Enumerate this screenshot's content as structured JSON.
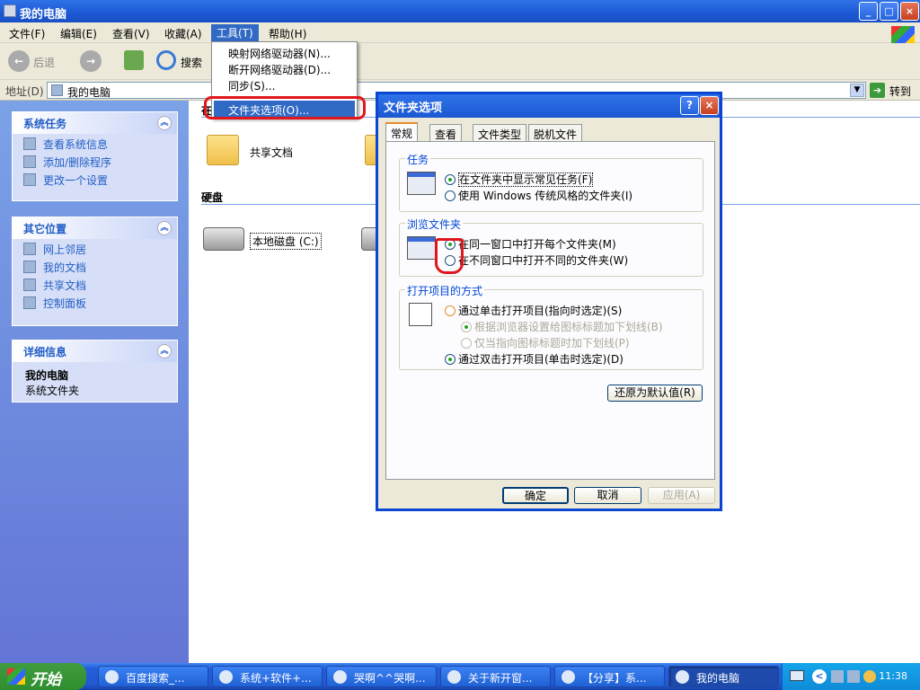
{
  "window": {
    "title": "我的电脑",
    "btn_min": "_",
    "btn_max": "□",
    "btn_close": "×"
  },
  "menubar": [
    "文件(F)",
    "编辑(E)",
    "查看(V)",
    "收藏(A)",
    "工具(T)",
    "帮助(H)"
  ],
  "toolbar": {
    "back": "后退",
    "search": "搜索"
  },
  "address": {
    "label": "地址(D)",
    "value": "我的电脑",
    "go": "转到"
  },
  "tools_menu": [
    "映射网络驱动器(N)...",
    "断开网络驱动器(D)...",
    "同步(S)...",
    "文件夹选项(O)..."
  ],
  "sidebar": {
    "system_tasks": {
      "title": "系统任务",
      "items": [
        "查看系统信息",
        "添加/删除程序",
        "更改一个设置"
      ]
    },
    "other_places": {
      "title": "其它位置",
      "items": [
        "网上邻居",
        "我的文档",
        "共享文档",
        "控制面板"
      ]
    },
    "details": {
      "title": "详细信息",
      "name": "我的电脑",
      "desc": "系统文件夹"
    }
  },
  "content": {
    "section1_prefix": "在",
    "shared_docs": "共享文档",
    "hdd_header": "硬盘",
    "local_disk": "本地磁盘 (C:)"
  },
  "dialog": {
    "title": "文件夹选项",
    "help": "?",
    "close": "×",
    "tabs": [
      "常规",
      "查看",
      "文件类型",
      "脱机文件"
    ],
    "tasks": {
      "legend": "任务",
      "opt1": "在文件夹中显示常见任务(F)",
      "opt2": "使用 Windows 传统风格的文件夹(I)"
    },
    "browse": {
      "legend": "浏览文件夹",
      "opt1": "在同一窗口中打开每个文件夹(M)",
      "opt2": "在不同窗口中打开不同的文件夹(W)"
    },
    "click": {
      "legend": "打开项目的方式",
      "opt1": "通过单击打开项目(指向时选定)(S)",
      "sub1": "根据浏览器设置给图标标题加下划线(B)",
      "sub2": "仅当指向图标标题时加下划线(P)",
      "opt2": "通过双击打开项目(单击时选定)(D)"
    },
    "restore": "还原为默认值(R)",
    "ok": "确定",
    "cancel": "取消",
    "apply": "应用(A)"
  },
  "taskbar": {
    "start": "开始",
    "items": [
      "百度搜索_...",
      "系统+软件+...",
      "哭啊^^哭啊...",
      "关于新开窗...",
      "【分享】系...",
      "我的电脑"
    ],
    "clock": "11:38"
  }
}
